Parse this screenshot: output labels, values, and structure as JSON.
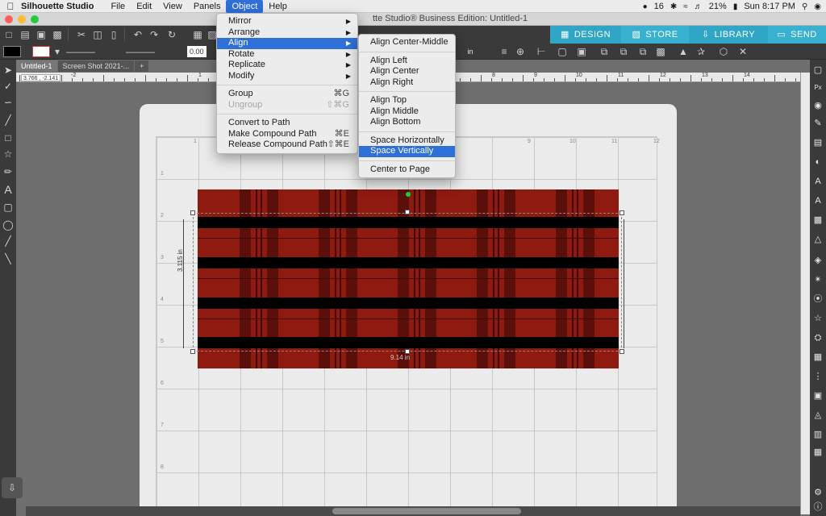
{
  "menubar": {
    "app_name": "Silhouette Studio",
    "items": [
      "File",
      "Edit",
      "View",
      "Panels",
      "Object",
      "Help"
    ],
    "active_item": "Object",
    "status": {
      "notifications": "16",
      "battery": "21%",
      "clock": "Sun 8:17 PM"
    }
  },
  "window": {
    "title": "tte Studio® Business Edition: Untitled-1"
  },
  "mode_tabs": [
    "DESIGN",
    "STORE",
    "LIBRARY",
    "SEND"
  ],
  "toolbar2": {
    "line_width": "0.00",
    "unit": "in"
  },
  "doc_tabs": [
    "Untitled-1",
    "Screen Shot 2021-..."
  ],
  "coords": "3.766 , -2.141",
  "hruler_numbers": [
    "-2",
    "1",
    "2",
    "3",
    "4",
    "5",
    "6",
    "7",
    "8",
    "9",
    "10",
    "11",
    "12",
    "13",
    "14"
  ],
  "grid_numbers_top": [
    "1",
    "9",
    "10",
    "11",
    "12"
  ],
  "grid_numbers_left": [
    "1",
    "2",
    "3",
    "4",
    "5",
    "6",
    "7",
    "8"
  ],
  "dimensions": {
    "height": "3.115 in",
    "width": "9.14 in"
  },
  "object_menu": [
    {
      "label": "Mirror",
      "submenu": true
    },
    {
      "label": "Arrange",
      "submenu": true
    },
    {
      "label": "Align",
      "submenu": true,
      "highlighted": true
    },
    {
      "label": "Rotate",
      "submenu": true
    },
    {
      "label": "Replicate",
      "submenu": true
    },
    {
      "label": "Modify",
      "submenu": true
    },
    {
      "sep": true
    },
    {
      "label": "Group",
      "shortcut": "⌘G"
    },
    {
      "label": "Ungroup",
      "shortcut": "⇧⌘G",
      "disabled": true
    },
    {
      "sep": true
    },
    {
      "label": "Convert to Path"
    },
    {
      "label": "Make Compound Path",
      "shortcut": "⌘E"
    },
    {
      "label": "Release Compound Path",
      "shortcut": "⇧⌘E"
    }
  ],
  "align_menu": [
    {
      "label": "Align Center-Middle"
    },
    {
      "sep": true
    },
    {
      "label": "Align Left"
    },
    {
      "label": "Align Center"
    },
    {
      "label": "Align Right"
    },
    {
      "sep": true
    },
    {
      "label": "Align Top"
    },
    {
      "label": "Align Middle"
    },
    {
      "label": "Align Bottom"
    },
    {
      "sep": true
    },
    {
      "label": "Space Horizontally"
    },
    {
      "label": "Space Vertically",
      "highlighted": true
    },
    {
      "sep": true
    },
    {
      "label": "Center to Page"
    }
  ],
  "colors": {
    "plaid_red": "#8e1a10",
    "plaid_dark": "#5a0f0a",
    "band_black": "#000000",
    "accent_teal": "#2fa6c6",
    "menu_highlight": "#2f6fd8"
  }
}
